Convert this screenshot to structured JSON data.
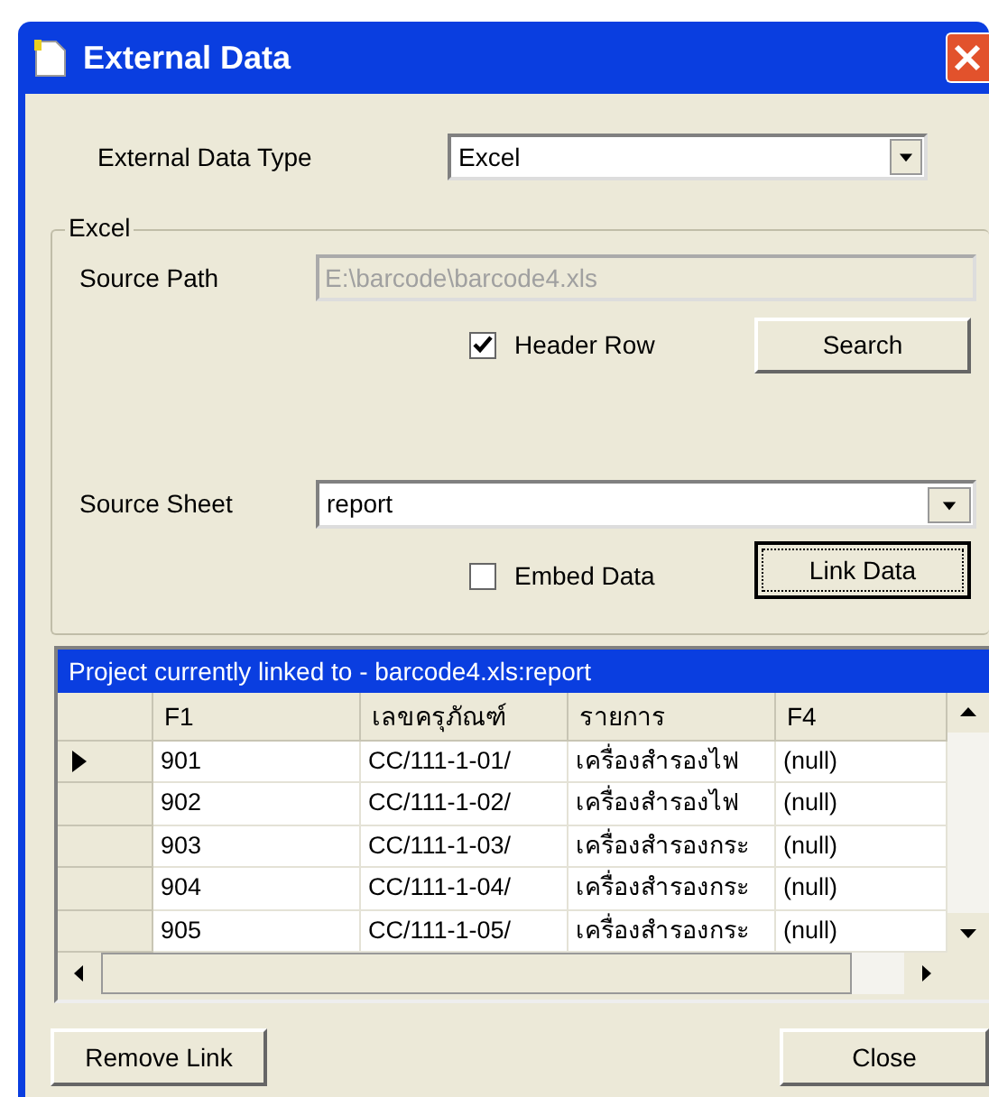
{
  "window": {
    "title": "External Data"
  },
  "data_type": {
    "label": "External Data Type",
    "value": "Excel"
  },
  "group": {
    "title": "Excel"
  },
  "source_path": {
    "label": "Source Path",
    "value": "E:\\barcode\\barcode4.xls",
    "disabled": true
  },
  "header_row": {
    "label": "Header Row",
    "checked": true
  },
  "search_button": "Search",
  "source_sheet": {
    "label": "Source Sheet",
    "value": "report"
  },
  "embed_data": {
    "label": "Embed Data",
    "checked": false
  },
  "link_button": {
    "label": "Link Data",
    "focused": true
  },
  "grid": {
    "caption": "Project currently linked to - barcode4.xls:report",
    "columns": [
      "F1",
      "เลขครุภัณฑ์",
      "รายการ",
      "F4"
    ],
    "rows": [
      {
        "current": true,
        "cells": [
          "901",
          "CC/111-1-01/",
          "เครื่องสำรองไฟ",
          "(null)"
        ]
      },
      {
        "current": false,
        "cells": [
          "902",
          "CC/111-1-02/",
          "เครื่องสำรองไฟ",
          "(null)"
        ]
      },
      {
        "current": false,
        "cells": [
          "903",
          "CC/111-1-03/",
          "เครื่องสำรองกระ",
          "(null)"
        ]
      },
      {
        "current": false,
        "cells": [
          "904",
          "CC/111-1-04/",
          "เครื่องสำรองกระ",
          "(null)"
        ]
      },
      {
        "current": false,
        "cells": [
          "905",
          "CC/111-1-05/",
          "เครื่องสำรองกระ",
          "(null)"
        ]
      }
    ]
  },
  "buttons": [
    "Remove Link",
    "Close"
  ]
}
